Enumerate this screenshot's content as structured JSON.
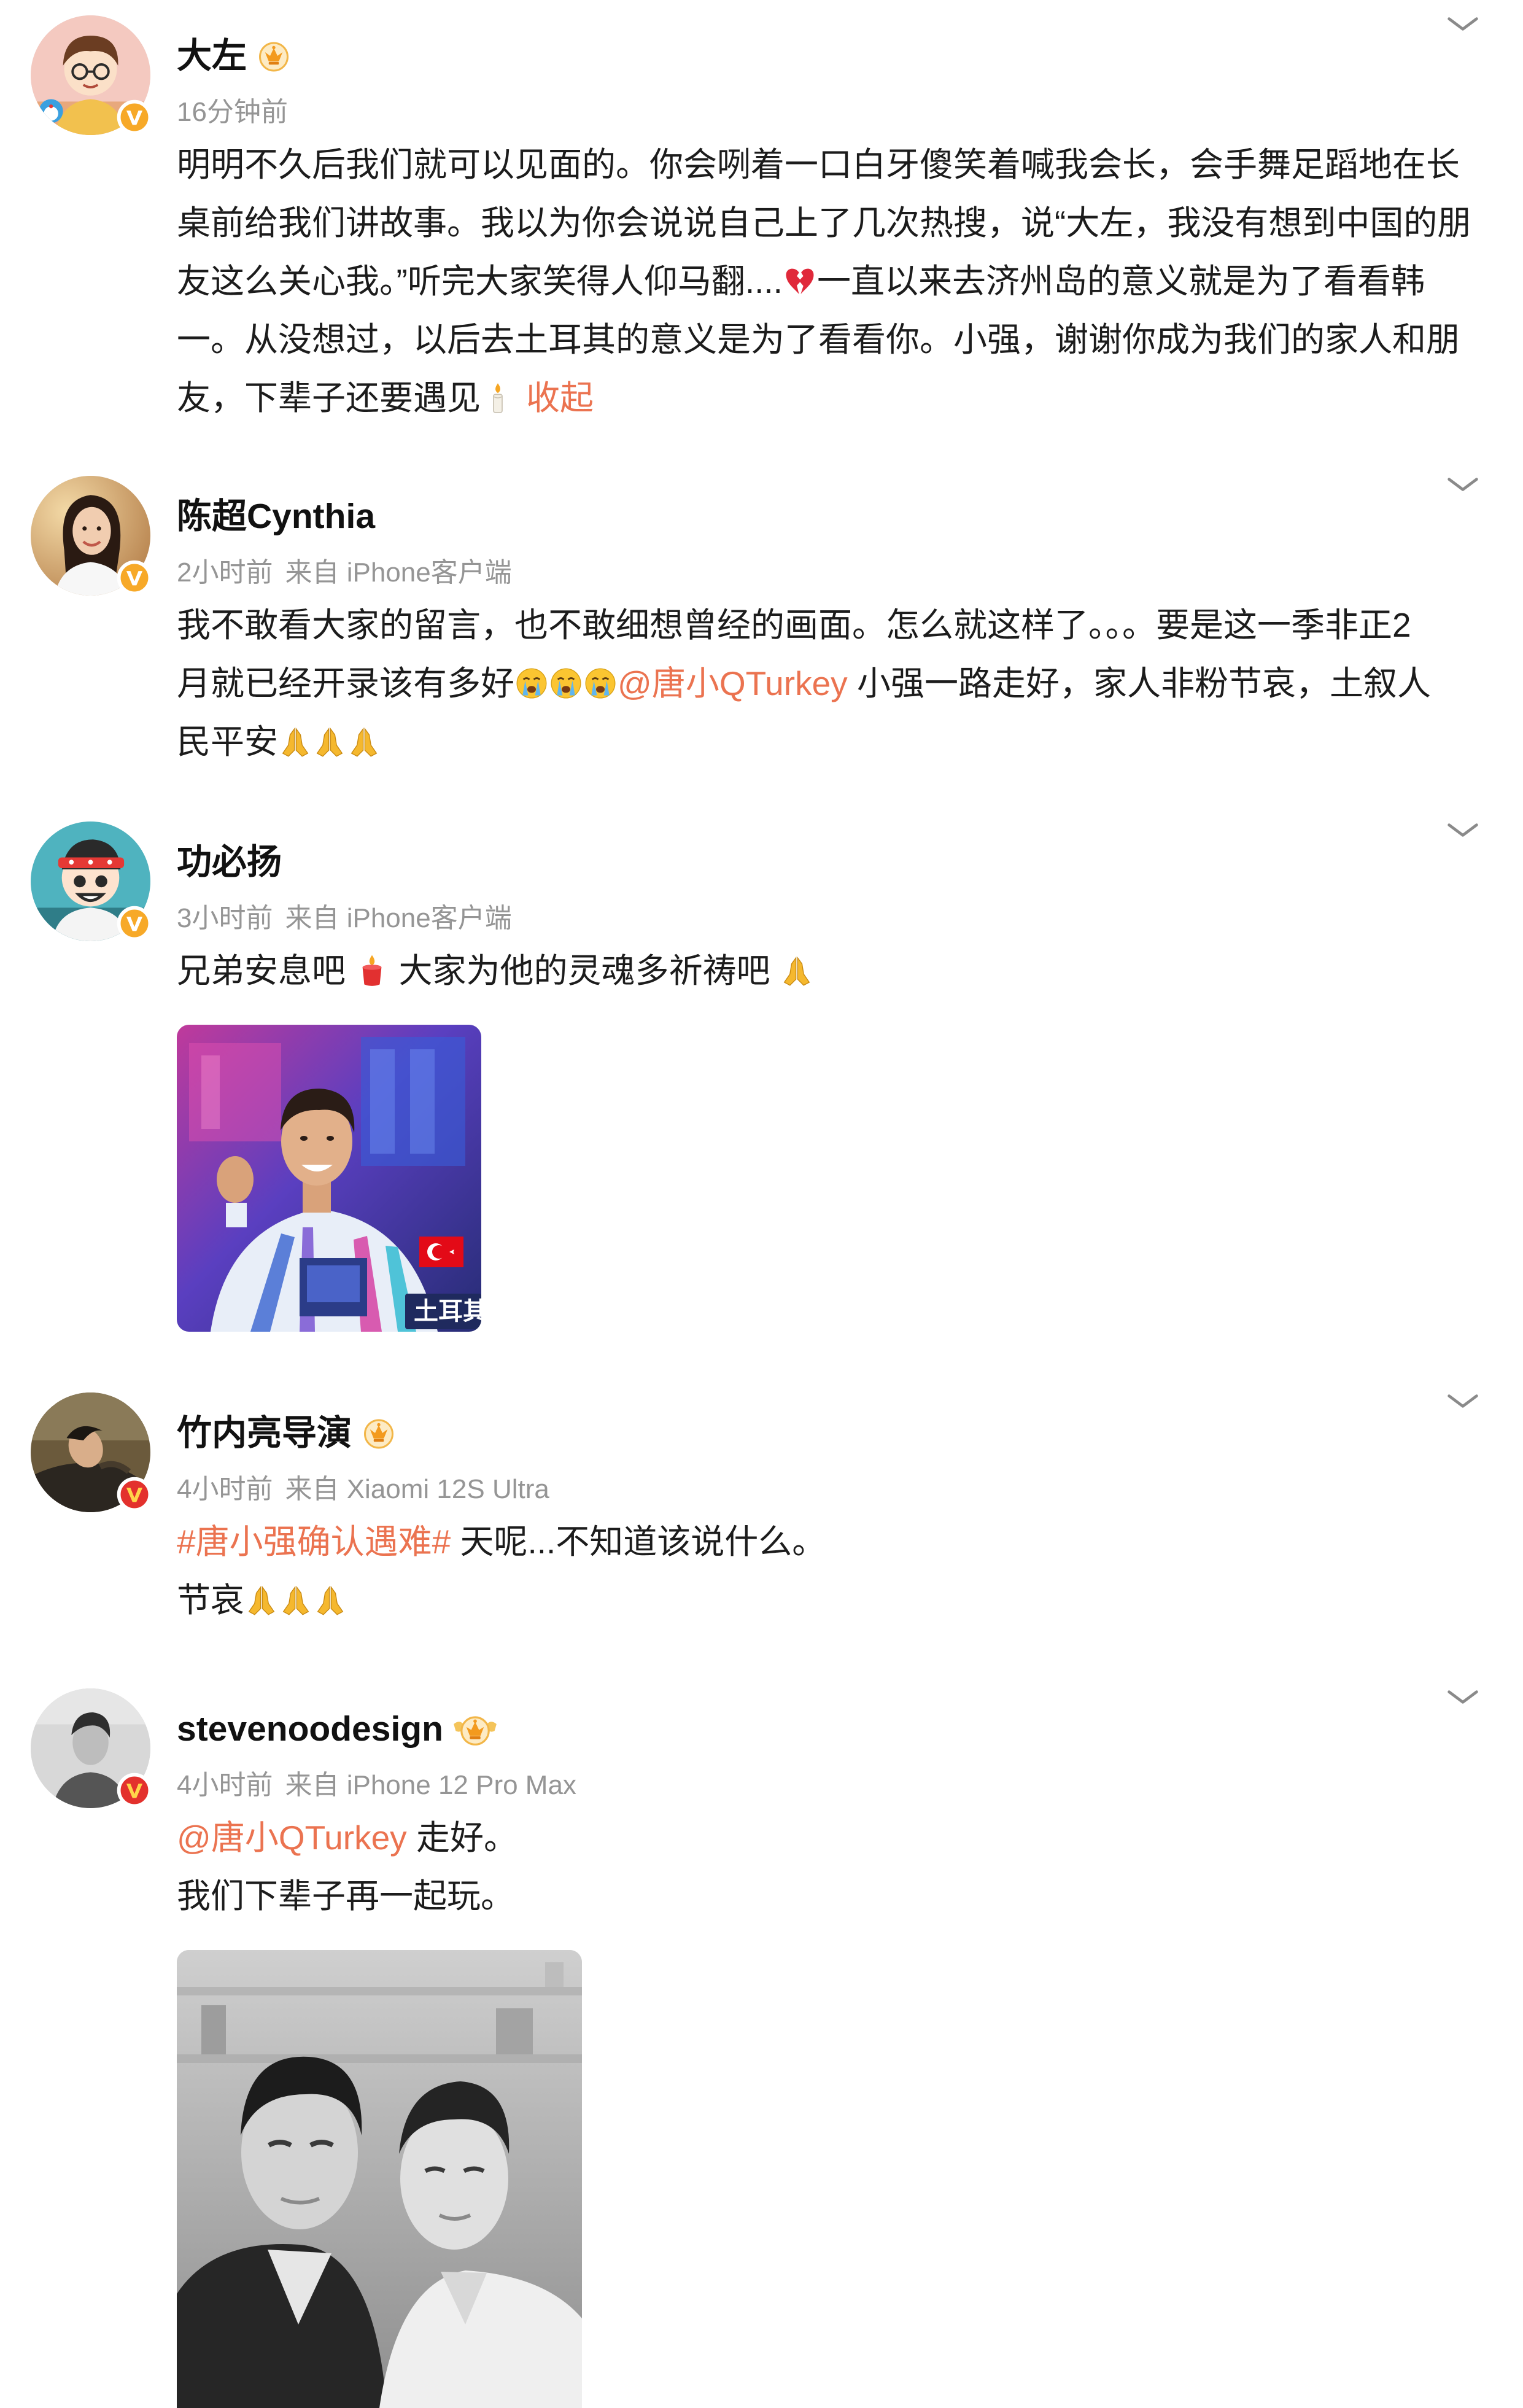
{
  "colors": {
    "link": "#eb7350",
    "name": "#111111",
    "meta": "#959595",
    "text": "#1c1c1c",
    "verified_yellow": "#f7a928",
    "verified_red": "#e3312d"
  },
  "feed": {
    "posts": [
      {
        "name": "大左",
        "badge": "crown-badge-icon",
        "verified": "verified-yellow-icon",
        "time": "16分钟前",
        "lines": [
          [
            {
              "text": "明明不久后我们就可以见面的。你会咧着一口白牙傻笑着喊我会长，会手舞足蹈地在长"
            }
          ],
          [
            {
              "text": "桌前给我们讲故事。我以为你会说说自己上了几次热搜，说“大左，我没有想到中国的朋"
            }
          ],
          [
            {
              "text": "友这么关心我。”听完大家笑得人仰马翻...."
            },
            {
              "icon": "broken-heart-icon"
            },
            {
              "text": "一直以来去济州岛的意义就是为了看看韩"
            }
          ],
          [
            {
              "text": "一。从没想过，以后去土耳其的意义是为了看看你。小强，谢谢你成为我们的家人和朋"
            }
          ],
          [
            {
              "text": "友，下辈子还要遇见"
            },
            {
              "icon": "candle-icon"
            },
            {
              "text": "收起",
              "kind": "collapse"
            }
          ]
        ]
      },
      {
        "name": "陈超Cynthia",
        "verified": "verified-yellow-icon",
        "time": "2小时前",
        "source": "来自 iPhone客户端",
        "lines": [
          [
            {
              "text": "我不敢看大家的留言，也不敢细想曾经的画面。怎么就这样了。。。要是这一季非正2"
            }
          ],
          [
            {
              "text": "月就已经开录该有多好"
            },
            {
              "icon": "cry-icon"
            },
            {
              "icon": "cry-icon"
            },
            {
              "icon": "cry-icon"
            },
            {
              "text": "@唐小QTurkey",
              "kind": "mention"
            },
            {
              "text": " 小强一路走好，家人非粉节哀，土叙人"
            }
          ],
          [
            {
              "text": "民平安"
            },
            {
              "icon": "pray-icon"
            },
            {
              "icon": "pray-icon"
            },
            {
              "icon": "pray-icon"
            }
          ]
        ]
      },
      {
        "name": "功必扬",
        "verified": "verified-yellow-icon",
        "time": "3小时前",
        "source": "来自 iPhone客户端",
        "lines": [
          [
            {
              "text": "兄弟安息吧 "
            },
            {
              "icon": "red-candle-icon"
            },
            {
              "text": " 大家为他的灵魂多祈祷吧 "
            },
            {
              "icon": "pray-icon"
            }
          ]
        ],
        "photo_caption": "土耳其"
      },
      {
        "name": "竹内亮导演",
        "badge": "crown-badge-icon",
        "verified": "verified-red-icon",
        "time": "4小时前",
        "source": "来自 Xiaomi 12S Ultra",
        "lines": [
          [
            {
              "text": "#唐小强确认遇难#",
              "kind": "hashtag"
            },
            {
              "text": " 天呢...不知道该说什么。"
            }
          ],
          [
            {
              "text": "节哀"
            },
            {
              "icon": "pray-icon"
            },
            {
              "icon": "pray-icon"
            },
            {
              "icon": "pray-icon"
            }
          ]
        ]
      },
      {
        "name": "stevenoodesign",
        "badge": "crown-badge-large-icon",
        "verified": "verified-red-icon",
        "time": "4小时前",
        "source": "来自 iPhone 12 Pro Max",
        "lines": [
          [
            {
              "text": "@唐小QTurkey",
              "kind": "mention"
            },
            {
              "text": " 走好。"
            }
          ],
          [
            {
              "text": "我们下辈子再一起玩。"
            }
          ]
        ]
      }
    ]
  }
}
